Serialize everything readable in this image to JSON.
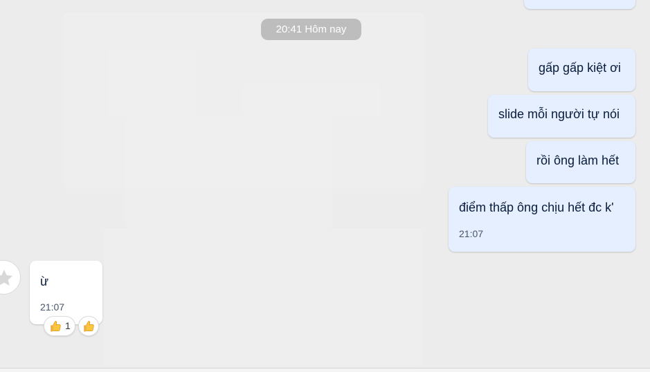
{
  "chat": {
    "time_divider": "20:41 Hôm nay",
    "outgoing": [
      {
        "text": "gấp gấp kiệt ơi"
      },
      {
        "text": "slide mỗi người tự nói"
      },
      {
        "text": "rồi ông làm hết"
      },
      {
        "text": "điểm thấp ông chịu hết đc k'",
        "time": "21:07"
      }
    ],
    "incoming": [
      {
        "text": "ừ",
        "time": "21:07"
      }
    ],
    "reactions": {
      "summary_count": "1"
    }
  },
  "icons": {
    "avatar": "star-icon",
    "reaction": "thumbs-up-icon"
  },
  "colors": {
    "outgoing_bubble": "#e5efff",
    "incoming_bubble": "#ffffff",
    "divider_bg": "#bdbdbd",
    "chat_bg": "#ececec",
    "text": "#081b3a"
  }
}
